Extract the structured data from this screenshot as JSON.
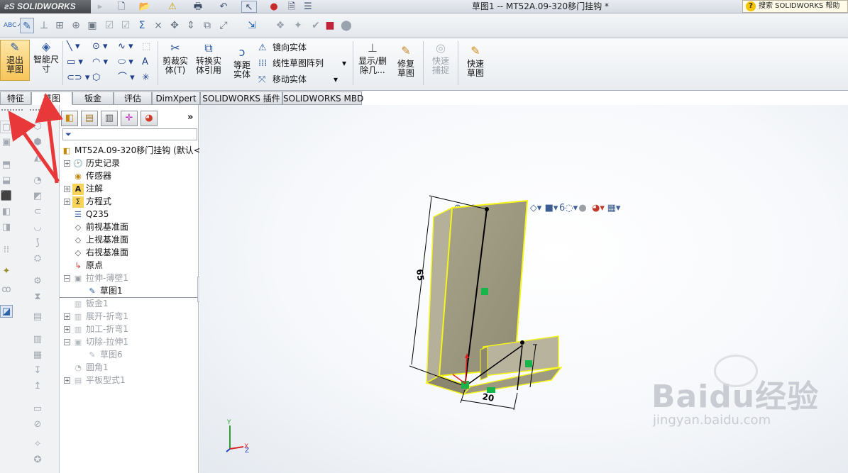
{
  "app": {
    "logo": "SOLIDWORKS",
    "title": "草图1 -- MT52A.09-320移门挂钩 *",
    "help_search": "搜索 SOLIDWORKS 帮助"
  },
  "ribbon": {
    "exit_sketch": "退出草图",
    "smart_dimension": "智能尺寸",
    "trim": "剪裁实体(T)",
    "convert": "转换实体引用",
    "offset": "等距实体",
    "mirror": "镜向实体",
    "linear_pattern": "线性草图阵列",
    "move": "移动实体",
    "display_delete": "显示/删除几...",
    "repair_sketch": "修复草图",
    "quick_snaps": "快速捕捉",
    "rapid_sketch": "快速草图"
  },
  "tabs": [
    {
      "label": "特征"
    },
    {
      "label": "草图"
    },
    {
      "label": "钣金"
    },
    {
      "label": "评估"
    },
    {
      "label": "DimXpert"
    },
    {
      "label": "SOLIDWORKS 插件"
    },
    {
      "label": "SOLIDWORKS MBD"
    }
  ],
  "tree": {
    "root": "MT52A.09-320移门挂钩 (默认<",
    "nodes": [
      {
        "label": "历史记录"
      },
      {
        "label": "传感器"
      },
      {
        "label": "注解"
      },
      {
        "label": "方程式"
      },
      {
        "label": "Q235"
      },
      {
        "label": "前视基准面"
      },
      {
        "label": "上视基准面"
      },
      {
        "label": "右视基准面"
      },
      {
        "label": "原点"
      },
      {
        "label": "拉伸-薄壁1"
      },
      {
        "label": "草图1"
      },
      {
        "label": "钣金1"
      },
      {
        "label": "展开-折弯1"
      },
      {
        "label": "加工-折弯1"
      },
      {
        "label": "切除-拉伸1"
      },
      {
        "label": "草图6"
      },
      {
        "label": "圆角1"
      },
      {
        "label": "平板型式1"
      }
    ]
  },
  "model": {
    "dim_height": "65",
    "dim_width": "20",
    "triad_y": "Y",
    "triad_x": "X",
    "triad_z": "Z"
  },
  "watermark": {
    "brand": "Baidu经验",
    "url": "jingyan.baidu.com"
  },
  "colors": {
    "sketch_highlight": "#f5f518",
    "part_face": "#a39f86",
    "relation_marker": "#17b54a",
    "annotation_arrow": "#e8383a"
  }
}
